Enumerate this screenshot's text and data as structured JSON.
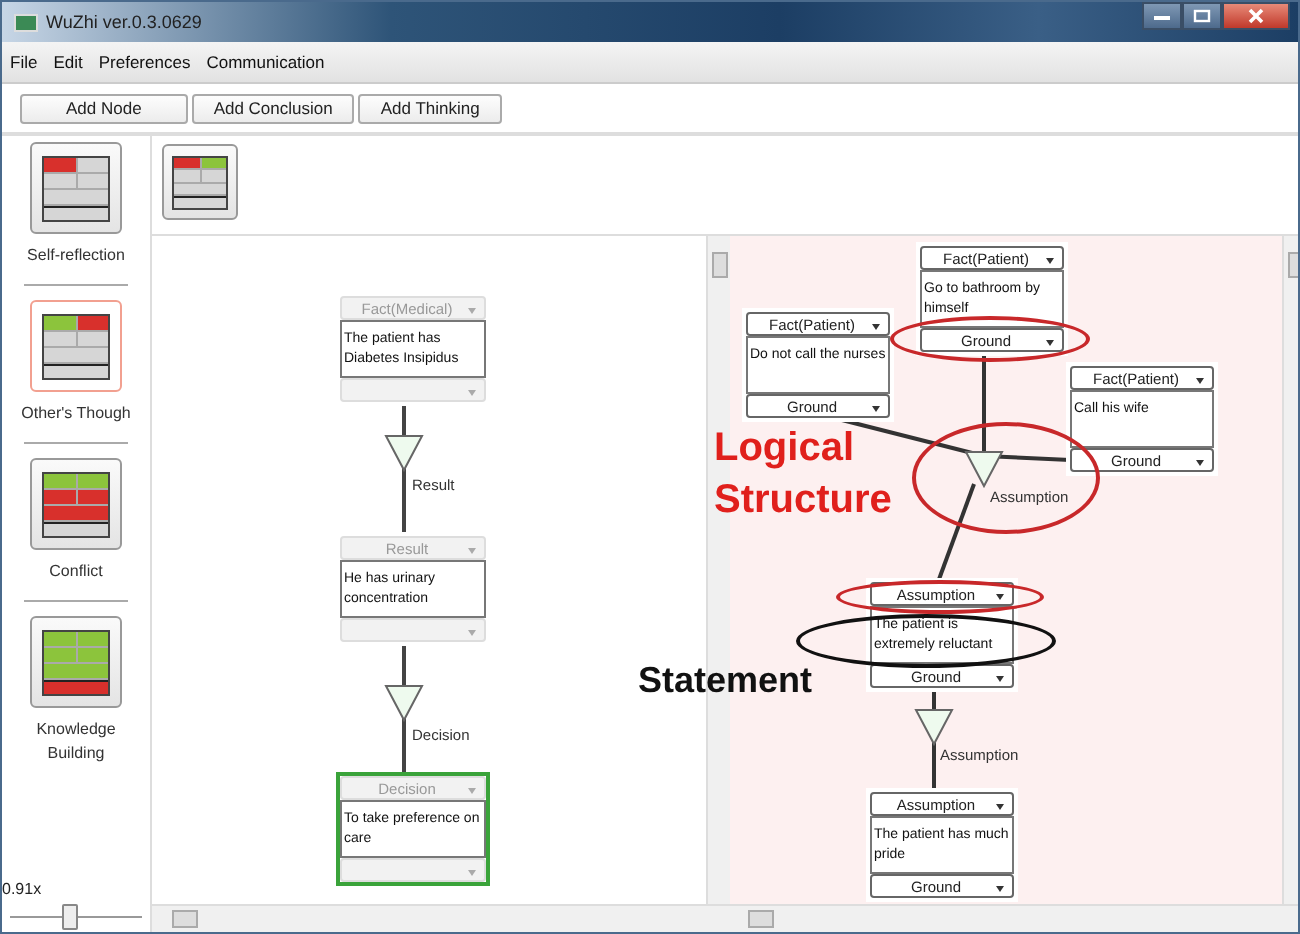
{
  "window": {
    "title": "WuZhi ver.0.3.0629"
  },
  "menu": [
    "File",
    "Edit",
    "Preferences",
    "Communication"
  ],
  "toolbar": [
    "Add Node",
    "Add Conclusion",
    "Add Thinking"
  ],
  "palettes": [
    {
      "kind": "self-reflection",
      "label": "Self-reflection",
      "selected": false
    },
    {
      "kind": "others",
      "label": "Other's Though",
      "selected": true
    },
    {
      "kind": "conflict",
      "label": "Conflict",
      "selected": false
    },
    {
      "kind": "knowledge",
      "label": "Knowledge Building",
      "selected": false
    }
  ],
  "strip": {
    "kind": "self-others"
  },
  "zoom": {
    "reading": "0.91x",
    "level": 0.45
  },
  "left_canvas": {
    "nodes": [
      {
        "type": "Fact(Medical)",
        "text": "The patient has Diabetes Insipidus",
        "disabled": true,
        "selected": false
      },
      {
        "type": "Result",
        "text": "He has urinary concentration",
        "disabled": true,
        "selected": false
      },
      {
        "type": "Decision",
        "text": "To take preference on care",
        "disabled": true,
        "selected": true
      }
    ],
    "connectors": [
      {
        "label": "Result"
      },
      {
        "label": "Decision"
      }
    ]
  },
  "right_canvas": {
    "nodes": [
      {
        "type": "Fact(Patient)",
        "text": "Go to bathroom by himself",
        "role": "Ground",
        "disabled": false,
        "selected": false
      },
      {
        "type": "Fact(Patient)",
        "text": "Do not call the nurses",
        "role": "Ground",
        "disabled": false,
        "selected": false
      },
      {
        "type": "Fact(Patient)",
        "text": "Call his wife",
        "role": "Ground",
        "disabled": false,
        "selected": false
      },
      {
        "type": "Assumption",
        "text": "The patient is extremely reluctant",
        "role": "Ground",
        "disabled": false,
        "selected": false
      },
      {
        "type": "Assumption",
        "text": "The patient has much pride",
        "role": "Ground",
        "disabled": false,
        "selected": false
      }
    ],
    "connectors": [
      {
        "label": "Assumption"
      },
      {
        "label": "Assumption"
      }
    ]
  },
  "annotations": [
    {
      "kind": "ellipse",
      "color": "#c8282a"
    },
    {
      "kind": "ellipse",
      "color": "#c8282a"
    },
    {
      "kind": "ellipse",
      "color": "#c8282a"
    },
    {
      "kind": "ellipse",
      "color": "#111111"
    },
    {
      "kind": "label",
      "text": "Logical Structure",
      "color": "#e0201c"
    },
    {
      "kind": "label",
      "text": "Statement",
      "color": "#111111"
    }
  ]
}
